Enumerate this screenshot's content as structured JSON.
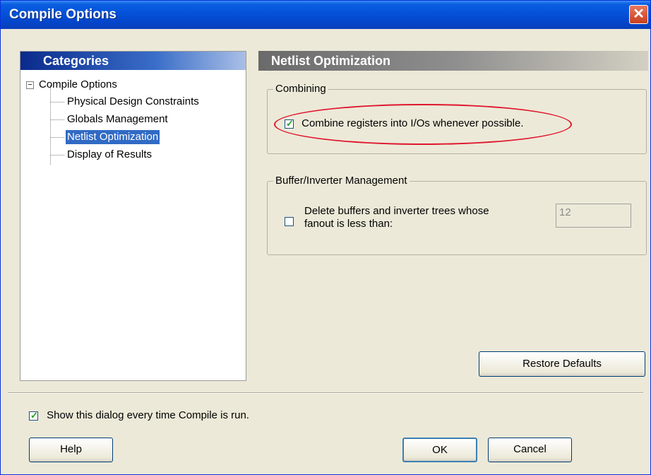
{
  "window": {
    "title": "Compile Options"
  },
  "categories": {
    "header": "Categories",
    "root": {
      "label": "Compile Options",
      "expander": "−"
    },
    "items": [
      {
        "label": "Physical Design Constraints",
        "selected": false
      },
      {
        "label": "Globals Management",
        "selected": false
      },
      {
        "label": "Netlist Optimization",
        "selected": true
      },
      {
        "label": "Display of Results",
        "selected": false
      }
    ]
  },
  "panel": {
    "header": "Netlist Optimization",
    "combining": {
      "legend": "Combining",
      "checkbox_label": "Combine registers into I/Os whenever possible.",
      "checked": true
    },
    "buffer": {
      "legend": "Buffer/Inverter Management",
      "checkbox_label_line1": "Delete buffers and inverter trees whose",
      "checkbox_label_line2": "fanout is less than:",
      "checked": false,
      "fanout_value": "12"
    },
    "restore_label": "Restore Defaults"
  },
  "footer": {
    "show_dialog_label": "Show this dialog every time Compile is run.",
    "show_dialog_checked": true,
    "help_label": "Help",
    "ok_label": "OK",
    "cancel_label": "Cancel"
  },
  "icons": {
    "close": "close-icon",
    "checkmark": "checkmark-icon"
  },
  "colors": {
    "title_bar": "#0553da",
    "selection": "#316ac5",
    "highlight_ellipse": "#e0142c",
    "close_button": "#c6401f"
  }
}
